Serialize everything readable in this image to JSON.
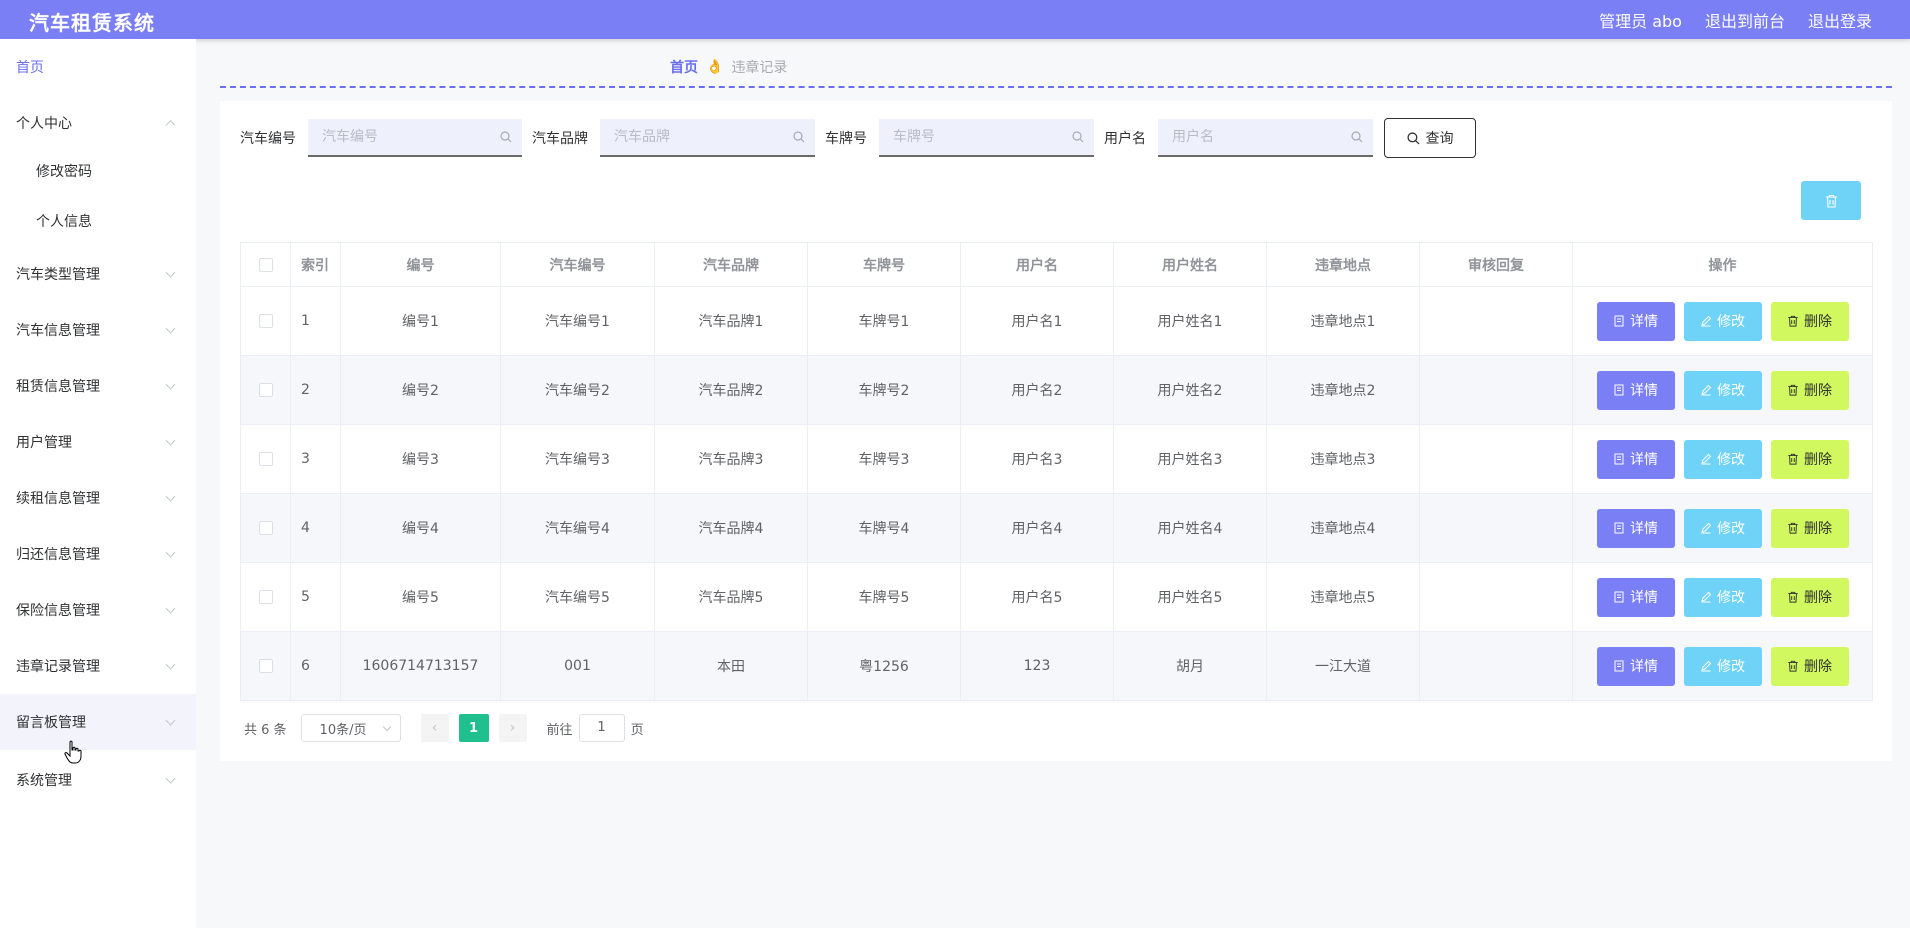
{
  "header": {
    "title": "汽车租赁系统",
    "admin_label": "管理员 abo",
    "front_link": "退出到前台",
    "logout_link": "退出登录"
  },
  "sidebar": {
    "items": [
      {
        "label": "首页"
      },
      {
        "label": "个人中心"
      },
      {
        "label": "修改密码"
      },
      {
        "label": "个人信息"
      },
      {
        "label": "汽车类型管理"
      },
      {
        "label": "汽车信息管理"
      },
      {
        "label": "租赁信息管理"
      },
      {
        "label": "用户管理"
      },
      {
        "label": "续租信息管理"
      },
      {
        "label": "归还信息管理"
      },
      {
        "label": "保险信息管理"
      },
      {
        "label": "违章记录管理"
      },
      {
        "label": "留言板管理"
      },
      {
        "label": "系统管理"
      }
    ]
  },
  "breadcrumb": {
    "home": "首页",
    "separator_icon": "👌",
    "current": "违章记录"
  },
  "filters": {
    "car_no_label": "汽车编号",
    "car_no_placeholder": "汽车编号",
    "car_brand_label": "汽车品牌",
    "car_brand_placeholder": "汽车品牌",
    "plate_label": "车牌号",
    "plate_placeholder": "车牌号",
    "username_label": "用户名",
    "username_placeholder": "用户名",
    "query_label": "查询"
  },
  "table": {
    "columns": [
      "索引",
      "编号",
      "汽车编号",
      "汽车品牌",
      "车牌号",
      "用户名",
      "用户姓名",
      "违章地点",
      "审核回复",
      "操作"
    ],
    "rows": [
      {
        "index": "1",
        "no": "编号1",
        "car_no": "汽车编号1",
        "brand": "汽车品牌1",
        "plate": "车牌号1",
        "username": "用户名1",
        "realname": "用户姓名1",
        "location": "违章地点1",
        "reply": ""
      },
      {
        "index": "2",
        "no": "编号2",
        "car_no": "汽车编号2",
        "brand": "汽车品牌2",
        "plate": "车牌号2",
        "username": "用户名2",
        "realname": "用户姓名2",
        "location": "违章地点2",
        "reply": ""
      },
      {
        "index": "3",
        "no": "编号3",
        "car_no": "汽车编号3",
        "brand": "汽车品牌3",
        "plate": "车牌号3",
        "username": "用户名3",
        "realname": "用户姓名3",
        "location": "违章地点3",
        "reply": ""
      },
      {
        "index": "4",
        "no": "编号4",
        "car_no": "汽车编号4",
        "brand": "汽车品牌4",
        "plate": "车牌号4",
        "username": "用户名4",
        "realname": "用户姓名4",
        "location": "违章地点4",
        "reply": ""
      },
      {
        "index": "5",
        "no": "编号5",
        "car_no": "汽车编号5",
        "brand": "汽车品牌5",
        "plate": "车牌号5",
        "username": "用户名5",
        "realname": "用户姓名5",
        "location": "违章地点5",
        "reply": ""
      },
      {
        "index": "6",
        "no": "1606714713157",
        "car_no": "001",
        "brand": "本田",
        "plate": "粤1256",
        "username": "123",
        "realname": "胡月",
        "location": "一江大道",
        "reply": ""
      }
    ],
    "actions": {
      "detail": "详情",
      "edit": "修改",
      "delete": "删除"
    }
  },
  "pagination": {
    "total": "共 6 条",
    "page_size": "10条/页",
    "current_page": "1",
    "goto_prefix": "前往",
    "goto_value": "1",
    "goto_suffix": "页"
  },
  "colors": {
    "primary": "#7b7ff5",
    "info": "#6fd3f7",
    "danger_lime": "#d1f85e",
    "page_active": "#1fc08e"
  }
}
